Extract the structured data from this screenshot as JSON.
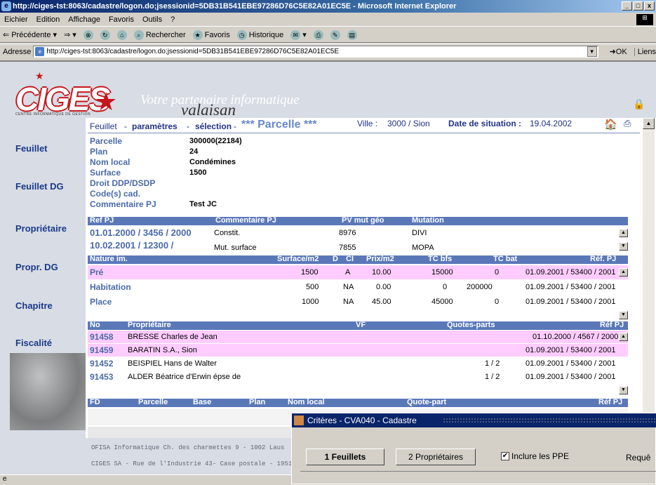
{
  "window": {
    "title": "http://ciges-tst:8063/cadastre/logon.do;jsessionid=5DB31B541EBE97286D76C5E82A01EC5E - Microsoft Internet Explorer"
  },
  "menu": [
    "Eichier",
    "Edition",
    "Affichage",
    "Favoris",
    "Outils",
    "?"
  ],
  "toolbar": {
    "back": "Précédente",
    "search": "Rechercher",
    "favorites": "Favoris",
    "history": "Historique"
  },
  "address": {
    "label": "Adresse",
    "url": "http://ciges-tst:8063/cadastre/logon.do;jsessionid=5DB31B541EBE97286D76C5E82A01EC5E",
    "go": "OK",
    "links": "Liens"
  },
  "brand": {
    "logo": "CIGES",
    "sub": "CENTRE INFORMATIQUE DE GESTION",
    "tagline": "Votre partenaire informatique",
    "region": "valaisan"
  },
  "nav": [
    "Feuillet",
    "Feuillet DG",
    "Propriétaire",
    "Propr. DG",
    "Chapitre",
    "Fiscalité"
  ],
  "breadcrumb": {
    "p1": "Feuillet",
    "sep1": "-",
    "p2": "paramètres",
    "sep2": "-",
    "p3": "sélection",
    "sep3": "-",
    "title": "*** Parcelle ***",
    "ville_label": "Ville :",
    "ville": "3000 / Sion",
    "date_label": "Date de situation :",
    "date": "19.04.2002"
  },
  "parcel": {
    "labels": [
      "Parcelle",
      "Plan",
      "Nom local",
      "Surface",
      "Droit DDP/DSDP",
      "Code(s) cad.",
      "Commentaire PJ"
    ],
    "values": [
      "300000(22184)",
      "24",
      "Condémines",
      "1500",
      "",
      "",
      "Test JC"
    ]
  },
  "mutations": {
    "headers": [
      "Ref PJ",
      "Commentaire PJ",
      "PV mut géo",
      "Mutation"
    ],
    "rows": [
      {
        "ref": "01.01.2000 / 3456 / 2000",
        "comment": "Constit.",
        "pv": "8976",
        "mutation": "DIVI"
      },
      {
        "ref": "10.02.2001 / 12300 /",
        "comment": "Mut. surface",
        "pv": "7855",
        "mutation": "MOPA"
      }
    ]
  },
  "nature": {
    "headers": [
      "Nature im.",
      "Surface/m2",
      "D",
      "CI",
      "Prix/m2",
      "TC bfs",
      "TC bat",
      "Réf. PJ"
    ],
    "rows": [
      {
        "nature": "Pré",
        "surface": "1500",
        "d": "",
        "ci": "A",
        "prix": "10.00",
        "tcbfs": "15000",
        "tcbat": "0",
        "ref": "01.09.2001 / 53400 / 2001"
      },
      {
        "nature": "Habitation",
        "surface": "500",
        "d": "",
        "ci": "NA",
        "prix": "0.00",
        "tcbfs": "0",
        "tcbat": "200000",
        "ref": "01.09.2001 / 53400 / 2001"
      },
      {
        "nature": "Place",
        "surface": "1000",
        "d": "",
        "ci": "NA",
        "prix": "45.00",
        "tcbfs": "45000",
        "tcbat": "0",
        "ref": "01.09.2001 / 53400 / 2001"
      }
    ]
  },
  "owners": {
    "headers": [
      "No",
      "Propriétaire",
      "VF",
      "Quotes-parts",
      "Réf PJ"
    ],
    "rows": [
      {
        "no": "91458",
        "name": "BRESSE Charles de Jean",
        "quote": "",
        "ref": "01.10.2000 / 4567 / 2000"
      },
      {
        "no": "91459",
        "name": "BARATIN S.A., Sion",
        "quote": "",
        "ref": "01.09.2001 / 53400 / 2001"
      },
      {
        "no": "91452",
        "name": "BEISPIEL Hans de Walter",
        "quote": "1 / 2",
        "ref": "01.09.2001 / 53400 / 2001"
      },
      {
        "no": "91453",
        "name": "ALDER Béatrice d'Erwin épse de",
        "quote": "1 / 2",
        "ref": "01.09.2001 / 53400 / 2001"
      }
    ]
  },
  "fd": {
    "headers": [
      "FD",
      "Parcelle",
      "Base",
      "Plan",
      "Nom local",
      "Quote-part",
      "Réf PJ"
    ]
  },
  "footer": {
    "line1": "OFISA Informatique Ch. des charmettes 9 - 1002 Laus",
    "line2": "CIGES SA - Rue de l'Industrie 43- Case postale - 1951"
  },
  "dialog": {
    "title": "Critères - CVA040 - Cadastre",
    "tab1": "1 Feuillets",
    "tab2": "2 Propriétaires",
    "checkbox": "Inclure les PPE",
    "request": "Requê"
  }
}
